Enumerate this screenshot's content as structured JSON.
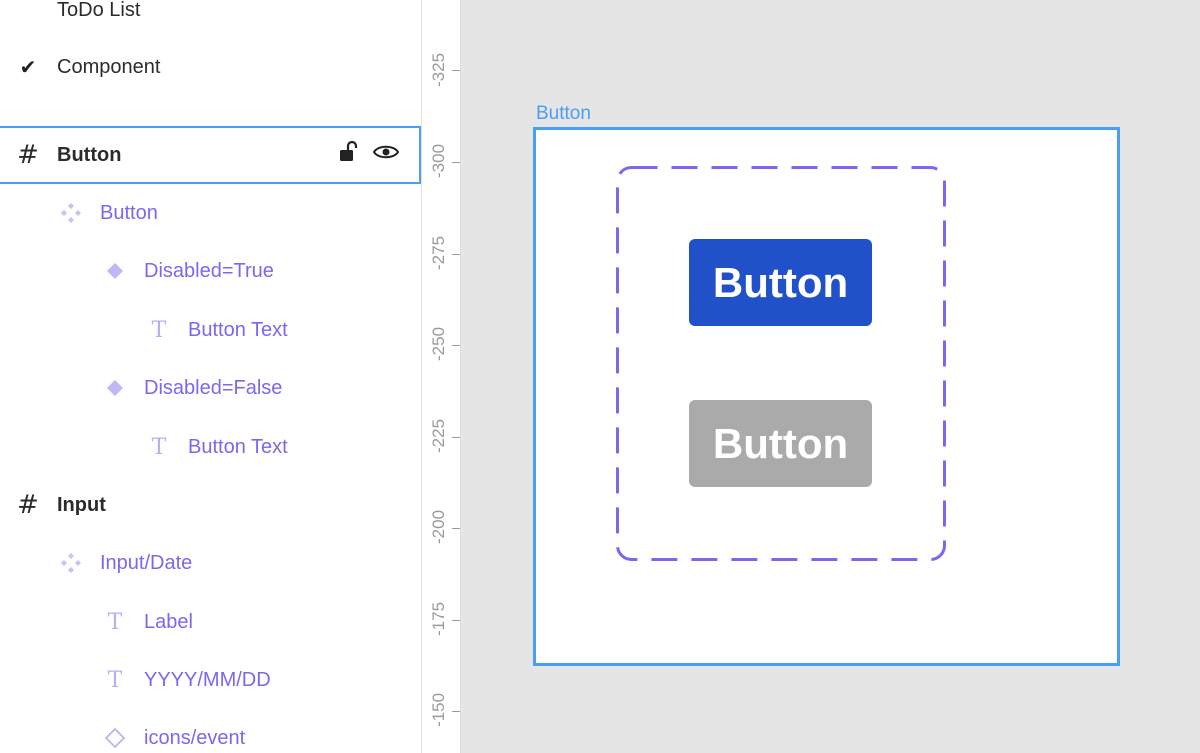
{
  "layers": {
    "todo_list": "ToDo List",
    "component": "Component",
    "button_frame": "Button",
    "button_component": "Button",
    "disabled_true": "Disabled=True",
    "button_text_1": "Button Text",
    "disabled_false": "Disabled=False",
    "button_text_2": "Button Text",
    "input_frame": "Input",
    "input_date": "Input/Date",
    "label": "Label",
    "date_placeholder": "YYYY/MM/DD",
    "icons_event": "icons/event"
  },
  "ruler": {
    "labels": [
      "-325",
      "-300",
      "-275",
      "-250",
      "-225",
      "-200",
      "-175",
      "-150"
    ]
  },
  "canvas": {
    "frame_label": "Button",
    "primary_button": "Button",
    "disabled_button": "Button"
  },
  "colors": {
    "selection": "#4a9ff5",
    "component_purple": "#7b68ee",
    "primary_button": "#2151c9",
    "disabled_button": "#aaaaaa",
    "canvas_bg": "#e5e5e5"
  }
}
